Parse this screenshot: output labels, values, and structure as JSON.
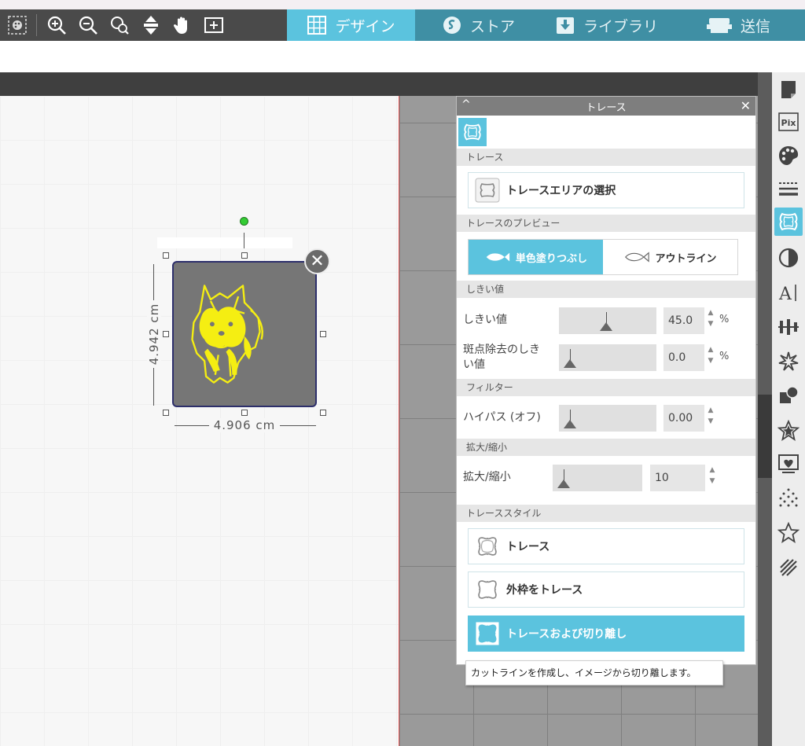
{
  "toolbar": {
    "tools": [
      "panel-toggle-icon",
      "zoom-in-icon",
      "zoom-out-icon",
      "zoom-select-icon",
      "fit-page-icon",
      "pan-hand-icon",
      "add-page-icon"
    ],
    "tabs": [
      {
        "label": "デザイン",
        "icon": "grid-icon",
        "active": true
      },
      {
        "label": "ストア",
        "icon": "store-icon"
      },
      {
        "label": "ライブラリ",
        "icon": "library-icon"
      },
      {
        "label": "送信",
        "icon": "send-icon"
      }
    ]
  },
  "canvas": {
    "width_label": "4.906 cm",
    "height_label": "4.942 cm",
    "close_symbol": "✕"
  },
  "panel": {
    "title": "トレース",
    "collapse_symbol": "^",
    "close_symbol": "✕",
    "sections": {
      "trace": "トレース",
      "preview": "トレースのプレビュー",
      "threshold": "しきい値",
      "filter": "フィルター",
      "scale": "拡大/縮小",
      "style": "トレーススタイル"
    },
    "select_area_label": "トレースエリアの選択",
    "preview_options": [
      "単色塗りつぶし",
      "アウトライン"
    ],
    "threshold": {
      "label": "しきい値",
      "value": "45.0",
      "unit": "%",
      "level": 0.45
    },
    "spot_removal": {
      "label_line1": "斑点除去のしき",
      "label_line2": "い値",
      "value": "0.0",
      "unit": "%",
      "level": 0.0
    },
    "high_pass": {
      "label": "ハイパス (オフ)",
      "value": "0.00",
      "level": 0.0
    },
    "scale": {
      "label": "拡大/縮小",
      "value": "10",
      "level": 0.0
    },
    "styles": [
      {
        "label": "トレース",
        "active": false
      },
      {
        "label": "外枠をトレース",
        "active": false
      },
      {
        "label": "トレースおよび切り離し",
        "active": true
      }
    ],
    "tooltip": "カットラインを作成し、イメージから切り離します。"
  },
  "sidebar": {
    "items": [
      "page-setup-icon",
      "pixscan-icon",
      "fill-palette-icon",
      "line-style-icon",
      "trace-icon",
      "transparency-icon",
      "text-icon",
      "align-icon",
      "replicate-icon",
      "modify-icon",
      "offset-icon",
      "sketch-icon",
      "image-effects-icon",
      "star-icon",
      "hatch-icon"
    ]
  },
  "colors": {
    "accent": "#5bc3de",
    "toolbar": "#4a4a4a",
    "object_fill": "#767676",
    "image_yellow": "#f5ee12"
  }
}
